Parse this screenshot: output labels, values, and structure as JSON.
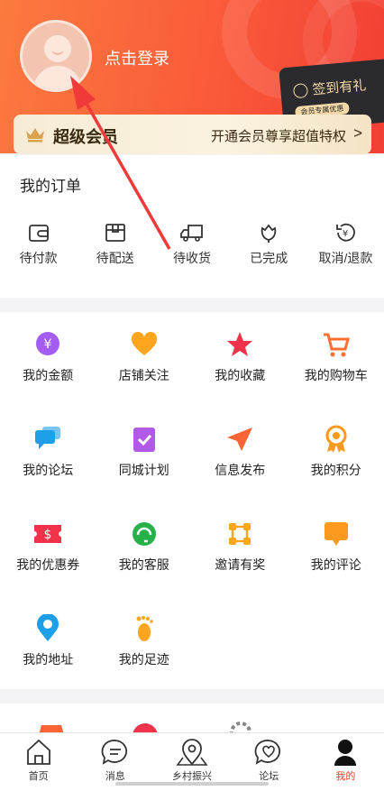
{
  "profile": {
    "login_label": "点击登录"
  },
  "sign_card": {
    "label": "签到有礼",
    "sub": "会员专属优惠"
  },
  "vip": {
    "title": "超级会员",
    "description": "开通会员尊享超值特权",
    "chevron": ">"
  },
  "orders": {
    "title": "我的订单",
    "items": [
      {
        "label": "待付款",
        "icon": "wallet-icon"
      },
      {
        "label": "待配送",
        "icon": "box-icon"
      },
      {
        "label": "待收货",
        "icon": "truck-icon"
      },
      {
        "label": "已完成",
        "icon": "flower-icon"
      },
      {
        "label": "取消/退款",
        "icon": "refund-icon"
      }
    ]
  },
  "services": [
    {
      "label": "我的金额",
      "icon": "yen-coin-icon",
      "color": "#a35df2"
    },
    {
      "label": "店铺关注",
      "icon": "heart-icon",
      "color": "#ffa51e"
    },
    {
      "label": "我的收藏",
      "icon": "star-icon",
      "color": "#f0334a"
    },
    {
      "label": "我的购物车",
      "icon": "cart-icon",
      "color": "#fb6f33"
    },
    {
      "label": "我的论坛",
      "icon": "chat-bubbles-icon",
      "color": "#1ea0e9"
    },
    {
      "label": "同城计划",
      "icon": "clipboard-check-icon",
      "color": "#b25ae8"
    },
    {
      "label": "信息发布",
      "icon": "paper-plane-icon",
      "color": "#fb6433"
    },
    {
      "label": "我的积分",
      "icon": "medal-icon",
      "color": "#fb9a1e"
    },
    {
      "label": "我的优惠券",
      "icon": "coupon-icon",
      "color": "#f0334a"
    },
    {
      "label": "我的客服",
      "icon": "headset-icon",
      "color": "#27b14a"
    },
    {
      "label": "邀请有奖",
      "icon": "share-nodes-icon",
      "color": "#ffa51e"
    },
    {
      "label": "我的评论",
      "icon": "comment-icon",
      "color": "#fb9a1e"
    },
    {
      "label": "我的地址",
      "icon": "location-pin-icon",
      "color": "#1ea0e9"
    },
    {
      "label": "我的足迹",
      "icon": "footprint-icon",
      "color": "#ffa51e"
    }
  ],
  "tabbar": [
    {
      "label": "首页",
      "icon": "home-icon",
      "active": false
    },
    {
      "label": "消息",
      "icon": "message-icon",
      "active": false
    },
    {
      "label": "乡村振兴",
      "icon": "map-pin-icon",
      "active": false
    },
    {
      "label": "论坛",
      "icon": "heart-chat-icon",
      "active": false
    },
    {
      "label": "我的",
      "icon": "person-icon",
      "active": true
    }
  ],
  "colors": {
    "header": "#fa5a3a",
    "active_tab": "#f23e34",
    "vip_bg": "#f8eed9"
  }
}
